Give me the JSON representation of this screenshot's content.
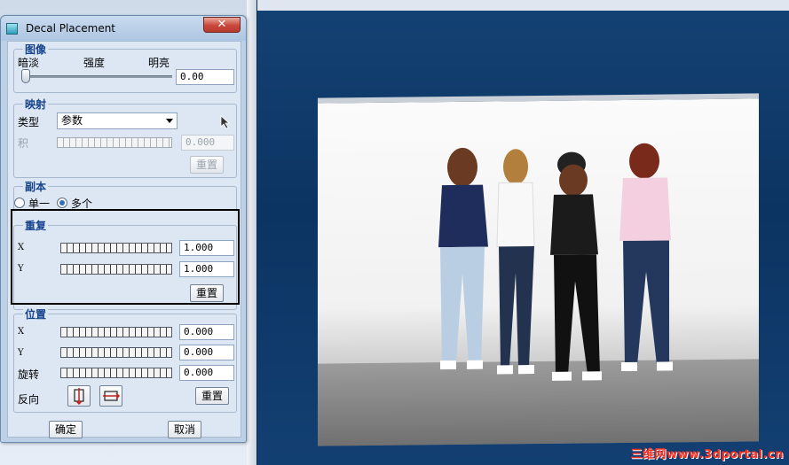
{
  "dialog": {
    "title": "Decal Placement",
    "close_icon": "close-icon",
    "image_group": {
      "title": "图像",
      "label_dark": "暗淡",
      "label_intensity": "强度",
      "label_bright": "明亮",
      "value": "0.00"
    },
    "mapping_group": {
      "title": "映射",
      "type_label": "类型",
      "type_value": "参数",
      "product_label": "积",
      "product_value": "0.000",
      "reset_label": "重置"
    },
    "copy_group": {
      "title": "副本",
      "single_label": "单一",
      "multiple_label": "多个",
      "selected": "multiple"
    },
    "repeat_group": {
      "title": "重复",
      "x_label": "X",
      "x_value": "1.000",
      "y_label": "Y",
      "y_value": "1.000",
      "reset_label": "重置"
    },
    "position_group": {
      "title": "位置",
      "x_label": "X",
      "x_value": "0.000",
      "y_label": "Y",
      "y_value": "0.000",
      "rotate_label": "旋转",
      "rotate_value": "0.000",
      "flip_label": "反向",
      "reset_label": "重置"
    },
    "ok_label": "确定",
    "cancel_label": "取消"
  },
  "viewport": {
    "watermark": "三维网www.3dportal.cn"
  },
  "colors": {
    "viewport_bg": "#0c3462",
    "group_title": "#15428b",
    "watermark": "#ff3020"
  }
}
